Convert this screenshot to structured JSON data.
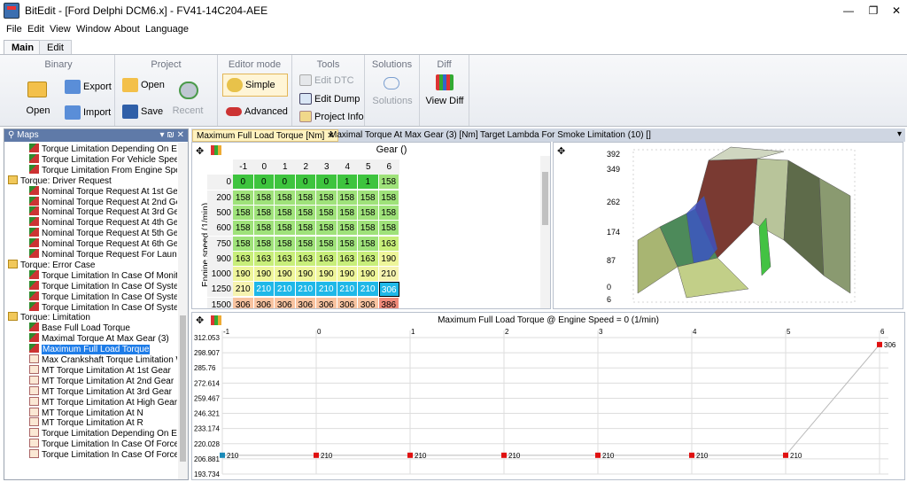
{
  "window": {
    "title": "BitEdit - [Ford Delphi DCM6.x] - FV41-14C204-AEE"
  },
  "menu": [
    "File",
    "Edit",
    "View",
    "Window",
    "About",
    "Language"
  ],
  "ribbon_tabs": [
    "Main",
    "Edit"
  ],
  "ribbon": {
    "binary": {
      "title": "Binary",
      "open": "Open",
      "export": "Export",
      "import": "Import"
    },
    "project": {
      "title": "Project",
      "open": "Open",
      "save": "Save",
      "recent": "Recent"
    },
    "editor": {
      "title": "Editor mode",
      "simple": "Simple",
      "advanced": "Advanced"
    },
    "tools": {
      "title": "Tools",
      "edit_dtc": "Edit DTC",
      "edit_dump": "Edit Dump",
      "project_info": "Project Info"
    },
    "solutions": {
      "title": "Solutions",
      "solutions": "Solutions"
    },
    "diff": {
      "title": "Diff",
      "view_diff": "View Diff"
    }
  },
  "maps_panel": {
    "title": "Maps",
    "controls": "▾ ₪ ✕"
  },
  "tree": [
    {
      "t": "Torque Limitation Depending On Enviro",
      "i": "g",
      "l": 2
    },
    {
      "t": "Torque Limitation For Vehicle Speed Lim",
      "i": "g",
      "l": 2
    },
    {
      "t": "Torque Limitation From Engine Speed",
      "i": "g",
      "l": 2
    },
    {
      "t": "Torque: Driver Request",
      "i": "f",
      "l": 1
    },
    {
      "t": "Nominal Torque Request At 1st Gear",
      "i": "g",
      "l": 2
    },
    {
      "t": "Nominal Torque Request At 2nd Gear",
      "i": "g",
      "l": 2
    },
    {
      "t": "Nominal Torque Request At 3rd Gear",
      "i": "g",
      "l": 2
    },
    {
      "t": "Nominal Torque Request At 4th Gear",
      "i": "g",
      "l": 2
    },
    {
      "t": "Nominal Torque Request At 5th Gear",
      "i": "g",
      "l": 2
    },
    {
      "t": "Nominal Torque Request At 6th Gear",
      "i": "g",
      "l": 2
    },
    {
      "t": "Nominal Torque Request For Launch Co",
      "i": "g",
      "l": 2
    },
    {
      "t": "Torque: Error Case",
      "i": "f",
      "l": 1
    },
    {
      "t": "Torque Limitation In Case Of Monitorinc",
      "i": "g",
      "l": 2
    },
    {
      "t": "Torque Limitation In Case Of System Err",
      "i": "g",
      "l": 2
    },
    {
      "t": "Torque Limitation In Case Of System Err",
      "i": "g",
      "l": 2
    },
    {
      "t": "Torque Limitation In Case Of System Err",
      "i": "g",
      "l": 2
    },
    {
      "t": "Torque: Limitation",
      "i": "f",
      "l": 1
    },
    {
      "t": "Base Full Load Torque",
      "i": "g",
      "l": 2
    },
    {
      "t": "Maximal Torque At Max Gear (3)",
      "i": "g",
      "l": 2
    },
    {
      "t": "Maximum Full Load Torque",
      "i": "g",
      "l": 2,
      "sel": true
    },
    {
      "t": "Max Crankshaft Torque Limitation With",
      "i": "t",
      "l": 2
    },
    {
      "t": "MT Torque Limitation At 1st Gear",
      "i": "t",
      "l": 2
    },
    {
      "t": "MT Torque Limitation At 2nd Gear",
      "i": "t",
      "l": 2
    },
    {
      "t": "MT Torque Limitation At 3rd Gear",
      "i": "t",
      "l": 2
    },
    {
      "t": "MT Torque Limitation At High Gears (3)",
      "i": "t",
      "l": 2
    },
    {
      "t": "MT Torque Limitation At N",
      "i": "t",
      "l": 2
    },
    {
      "t": "MT Torque Limitation At R",
      "i": "t",
      "l": 2
    },
    {
      "t": "Torque Limitation Depending On Engin",
      "i": "t",
      "l": 2
    },
    {
      "t": "Torque Limitation In Case Of Forced Bit",
      "i": "t",
      "l": 2
    },
    {
      "t": "Torque Limitation In Case Of Forced Mc",
      "i": "t",
      "l": 2
    }
  ],
  "doc_tabs": [
    "Maximum Full Load Torque [Nm]",
    "Maximal Torque At Max Gear (3) [Nm]",
    "Target Lambda For Smoke Limitation (10) []"
  ],
  "grid": {
    "x_label": "Gear ()",
    "y_label": "Engine speed (1/min)",
    "cols": [
      "-1",
      "0",
      "1",
      "2",
      "3",
      "4",
      "5",
      "6"
    ],
    "rows": [
      {
        "rpm": "0",
        "v": [
          "0",
          "0",
          "0",
          "0",
          "0",
          "1",
          "1",
          "158"
        ]
      },
      {
        "rpm": "200",
        "v": [
          "158",
          "158",
          "158",
          "158",
          "158",
          "158",
          "158",
          "158"
        ]
      },
      {
        "rpm": "500",
        "v": [
          "158",
          "158",
          "158",
          "158",
          "158",
          "158",
          "158",
          "158"
        ]
      },
      {
        "rpm": "600",
        "v": [
          "158",
          "158",
          "158",
          "158",
          "158",
          "158",
          "158",
          "158"
        ]
      },
      {
        "rpm": "750",
        "v": [
          "158",
          "158",
          "158",
          "158",
          "158",
          "158",
          "158",
          "163"
        ]
      },
      {
        "rpm": "900",
        "v": [
          "163",
          "163",
          "163",
          "163",
          "163",
          "163",
          "163",
          "190"
        ]
      },
      {
        "rpm": "1000",
        "v": [
          "190",
          "190",
          "190",
          "190",
          "190",
          "190",
          "190",
          "210"
        ]
      },
      {
        "rpm": "1250",
        "v": [
          "210",
          "210",
          "210",
          "210",
          "210",
          "210",
          "210",
          "306"
        ]
      },
      {
        "rpm": "1500",
        "v": [
          "306",
          "306",
          "306",
          "306",
          "306",
          "306",
          "306",
          "386"
        ]
      }
    ]
  },
  "graph3d": {
    "z_ticks": [
      "392",
      "349",
      "262",
      "174",
      "87",
      "0",
      "6"
    ]
  },
  "graph2d": {
    "title": "Maximum Full Load Torque @ Engine Speed = 0 (1/min)",
    "x_ticks": [
      "-1",
      "0",
      "1",
      "2",
      "3",
      "4",
      "5",
      "6"
    ],
    "y_ticks": [
      "312.053",
      "298.907",
      "285.76",
      "272.614",
      "259.467",
      "246.321",
      "233.174",
      "220.028",
      "206.881",
      "193.734"
    ],
    "points": [
      {
        "x": -1,
        "y": 210
      },
      {
        "x": 0,
        "y": 210
      },
      {
        "x": 1,
        "y": 210
      },
      {
        "x": 2,
        "y": 210
      },
      {
        "x": 3,
        "y": 210
      },
      {
        "x": 4,
        "y": 210
      },
      {
        "x": 5,
        "y": 210
      },
      {
        "x": 6,
        "y": 306
      }
    ],
    "point_labels": [
      "210",
      "210",
      "210",
      "210",
      "210",
      "210",
      "210",
      "306"
    ]
  }
}
